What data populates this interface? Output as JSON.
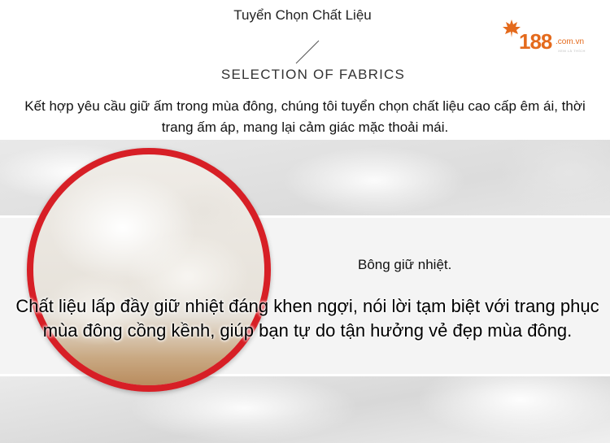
{
  "header": {
    "title": "Tuyển Chọn Chất Liệu",
    "subtitle": "SELECTION OF FABRICS"
  },
  "logo": {
    "number": "188",
    "domain": ".com.vn",
    "tagline": "XEM LÀ THÍCH",
    "brand_color": "#e46a1c"
  },
  "intro_text": "Kết hợp yêu cầu giữ ấm trong mùa đông, chúng tôi tuyển chọn chất liệu cao cấp êm ái, thời trang ấm áp, mang lại cảm giác mặc thoải mái.",
  "feature": {
    "label": "Bông giữ nhiệt.",
    "description": "Chất liệu lấp đầy giữ nhiệt đáng khen ngợi, nói lời tạm biệt với trang phục mùa đông cồng kềnh, giúp bạn tự do tận hưởng vẻ đẹp mùa đông.",
    "ring_color": "#d71f26"
  }
}
